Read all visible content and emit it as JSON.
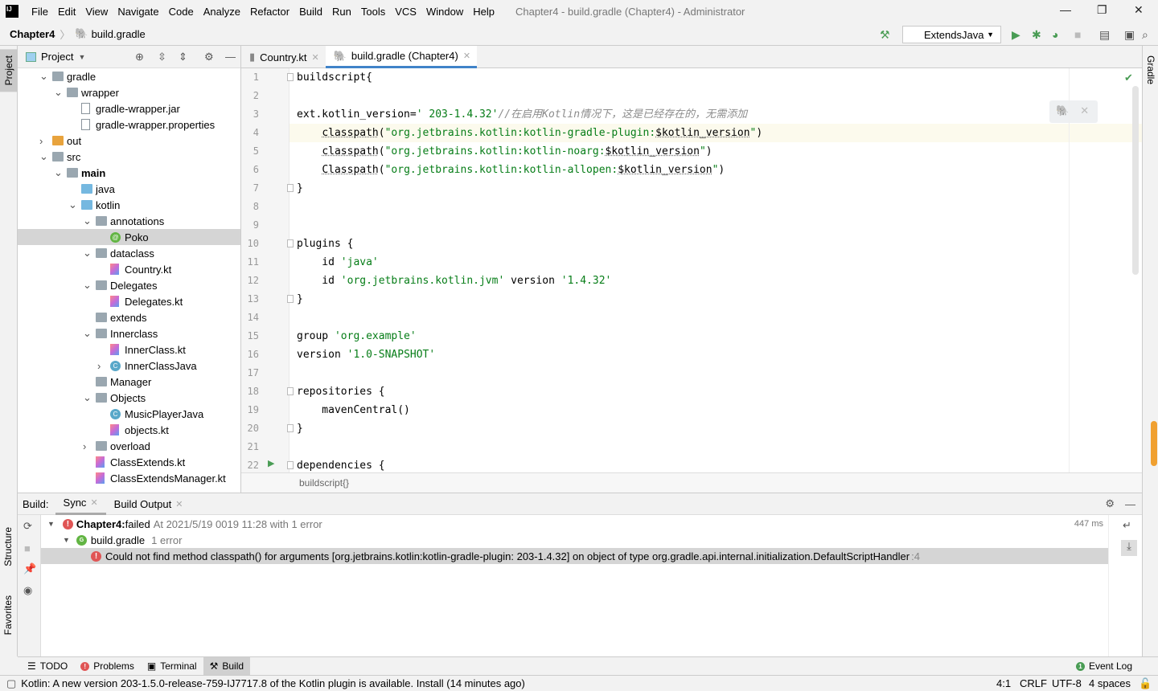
{
  "titlebar": {
    "menu": [
      "File",
      "Edit",
      "View",
      "Navigate",
      "Code",
      "Analyze",
      "Refactor",
      "Build",
      "Run",
      "Tools",
      "VCS",
      "Window",
      "Help"
    ],
    "title": "Chapter4 - build.gradle (Chapter4) - Administrator"
  },
  "navbar": {
    "project": "Chapter4",
    "file": "build.gradle",
    "run_config": "ExtendsJava"
  },
  "left_stripe": {
    "project": "Project",
    "structure": "Structure",
    "favorites": "Favorites"
  },
  "right_stripe": {
    "gradle": "Gradle"
  },
  "project_panel": {
    "title": "Project",
    "tree": [
      {
        "label": "gradle",
        "level": 0,
        "arrow": "down",
        "icon": "folder"
      },
      {
        "label": "wrapper",
        "level": 1,
        "arrow": "down",
        "icon": "folder"
      },
      {
        "label": "gradle-wrapper.jar",
        "level": 2,
        "arrow": "",
        "icon": "file"
      },
      {
        "label": "gradle-wrapper.properties",
        "level": 2,
        "arrow": "",
        "icon": "file"
      },
      {
        "label": "out",
        "level": 0,
        "arrow": "right",
        "icon": "folder orange"
      },
      {
        "label": "src",
        "level": 0,
        "arrow": "down",
        "icon": "folder"
      },
      {
        "label": "main",
        "level": 1,
        "arrow": "down",
        "icon": "folder",
        "bold": true
      },
      {
        "label": "java",
        "level": 2,
        "arrow": "",
        "icon": "folder blue"
      },
      {
        "label": "kotlin",
        "level": 2,
        "arrow": "down",
        "icon": "folder blue"
      },
      {
        "label": "annotations",
        "level": 3,
        "arrow": "down",
        "icon": "folder"
      },
      {
        "label": "Poko",
        "level": 4,
        "arrow": "",
        "icon": "anno",
        "selected": true
      },
      {
        "label": "dataclass",
        "level": 3,
        "arrow": "down",
        "icon": "folder"
      },
      {
        "label": "Country.kt",
        "level": 4,
        "arrow": "",
        "icon": "kt"
      },
      {
        "label": "Delegates",
        "level": 3,
        "arrow": "down",
        "icon": "folder"
      },
      {
        "label": "Delegates.kt",
        "level": 4,
        "arrow": "",
        "icon": "kt"
      },
      {
        "label": "extends",
        "level": 3,
        "arrow": "",
        "icon": "folder"
      },
      {
        "label": "Innerclass",
        "level": 3,
        "arrow": "down",
        "icon": "folder"
      },
      {
        "label": "InnerClass.kt",
        "level": 4,
        "arrow": "",
        "icon": "kt"
      },
      {
        "label": "InnerClassJava",
        "level": 4,
        "arrow": "right",
        "icon": "cls"
      },
      {
        "label": "Manager",
        "level": 3,
        "arrow": "",
        "icon": "folder"
      },
      {
        "label": "Objects",
        "level": 3,
        "arrow": "down",
        "icon": "folder"
      },
      {
        "label": "MusicPlayerJava",
        "level": 4,
        "arrow": "",
        "icon": "cls"
      },
      {
        "label": "objects.kt",
        "level": 4,
        "arrow": "",
        "icon": "kt"
      },
      {
        "label": "overload",
        "level": 3,
        "arrow": "right",
        "icon": "folder"
      },
      {
        "label": "ClassExtends.kt",
        "level": 3,
        "arrow": "",
        "icon": "kt"
      },
      {
        "label": "ClassExtendsManager.kt",
        "level": 3,
        "arrow": "",
        "icon": "kt"
      }
    ]
  },
  "tabs": [
    {
      "label": "Country.kt",
      "active": false
    },
    {
      "label": "build.gradle (Chapter4)",
      "active": true
    }
  ],
  "editor": {
    "current_line": 4,
    "lines": [
      [
        [
          "buildscript{",
          ""
        ]
      ],
      [],
      [
        [
          "ext.kotlin_version=",
          ""
        ],
        [
          "' 203-1.4.32'",
          "str"
        ],
        [
          "//在启用Kotlin情况下，这是已经存在的，无需添加",
          "cmt"
        ]
      ],
      [
        [
          "    ",
          ""
        ],
        [
          "classpath",
          "warn"
        ],
        [
          "(",
          ""
        ],
        [
          "\"org.jetbrains.kotlin:kotlin-gradle-plugin:",
          "str"
        ],
        [
          "$kotlin_version",
          "var warn"
        ],
        [
          "\"",
          "str"
        ],
        [
          ")",
          ""
        ]
      ],
      [
        [
          "    ",
          ""
        ],
        [
          "classpath",
          "warn"
        ],
        [
          "(",
          ""
        ],
        [
          "\"org.jetbrains.kotlin:kotlin-noarg:",
          "str"
        ],
        [
          "$kotlin_version",
          "var warn"
        ],
        [
          "\"",
          "str"
        ],
        [
          ")",
          ""
        ]
      ],
      [
        [
          "    ",
          ""
        ],
        [
          "Classpath",
          "warn"
        ],
        [
          "(",
          ""
        ],
        [
          "\"org.jetbrains.kotlin:kotlin-allopen:",
          "str"
        ],
        [
          "$kotlin_version",
          "var warn"
        ],
        [
          "\"",
          "str"
        ],
        [
          ")",
          ""
        ]
      ],
      [
        [
          "}",
          ""
        ]
      ],
      [],
      [],
      [
        [
          "plugins {",
          ""
        ]
      ],
      [
        [
          "    id ",
          ""
        ],
        [
          "'java'",
          "str"
        ]
      ],
      [
        [
          "    id ",
          ""
        ],
        [
          "'org.jetbrains.kotlin.jvm'",
          "str"
        ],
        [
          " version ",
          ""
        ],
        [
          "'1.4.32'",
          "str"
        ]
      ],
      [
        [
          "}",
          ""
        ]
      ],
      [],
      [
        [
          "group ",
          ""
        ],
        [
          "'org.example'",
          "str"
        ]
      ],
      [
        [
          "version ",
          ""
        ],
        [
          "'1.0-SNAPSHOT'",
          "str"
        ]
      ],
      [],
      [
        [
          "repositories {",
          ""
        ]
      ],
      [
        [
          "    mavenCentral()",
          ""
        ]
      ],
      [
        [
          "}",
          ""
        ]
      ],
      [],
      [
        [
          "dependencies {",
          ""
        ]
      ]
    ],
    "breadcrumb": "buildscript{}"
  },
  "build": {
    "label": "Build:",
    "tabs": [
      "Sync",
      "Build Output"
    ],
    "root": {
      "name": "Chapter4:",
      "status": " failed",
      "detail": "At 2021/5/19 0019 11:28 with 1 error",
      "time": "447 ms"
    },
    "file": {
      "name": "build.gradle",
      "detail": "1 error"
    },
    "error": "Could not find method classpath() for arguments [org.jetbrains.kotlin:kotlin-gradle-plugin: 203-1.4.32] on object of type org.gradle.api.internal.initialization.DefaultScriptHandler",
    "error_line": ":4"
  },
  "toolwindows": [
    "TODO",
    "Problems",
    "Terminal",
    "Build"
  ],
  "event_log": "Event Log",
  "status": {
    "message": "Kotlin: A new version 203-1.5.0-release-759-IJ7717.8 of the Kotlin plugin is available. Install (14 minutes ago)",
    "position": "4:1",
    "line_sep": "CRLF",
    "encoding": "UTF-8",
    "indent": "4 spaces"
  }
}
